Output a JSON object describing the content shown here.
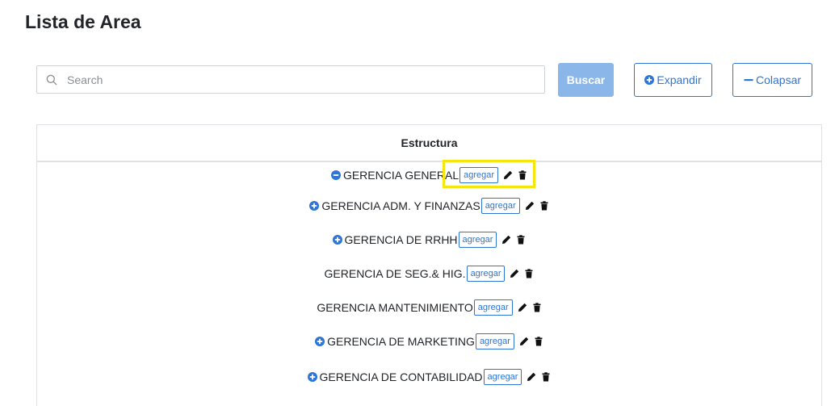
{
  "page": {
    "title": "Lista de Area"
  },
  "search": {
    "placeholder": "Search",
    "value": "",
    "icon": "search-icon"
  },
  "toolbar": {
    "buscar_label": "Buscar",
    "expandir_label": "Expandir",
    "expandir_icon": "plus-circle-icon",
    "colapsar_label": "Colapsar",
    "colapsar_icon": "minus-icon"
  },
  "tree": {
    "header": "Estructura",
    "add_label": "agregar",
    "rows": [
      {
        "label": "GERENCIA GENERAL",
        "toggle": "minus",
        "highlighted": true
      },
      {
        "label": "GERENCIA ADM. Y FINANZAS",
        "toggle": "plus"
      },
      {
        "label": "GERENCIA DE RRHH",
        "toggle": "plus"
      },
      {
        "label": "GERENCIA DE SEG.& HIG.",
        "toggle": "none"
      },
      {
        "label": "GERENCIA MANTENIMIENTO",
        "toggle": "none"
      },
      {
        "label": "GERENCIA DE MARKETING",
        "toggle": "plus"
      },
      {
        "label": "GERENCIA DE CONTABILIDAD",
        "toggle": "plus"
      }
    ]
  },
  "colors": {
    "accent": "#2e75d6",
    "buscar_bg": "#8ab6ea",
    "highlight": "#f5e60c"
  }
}
